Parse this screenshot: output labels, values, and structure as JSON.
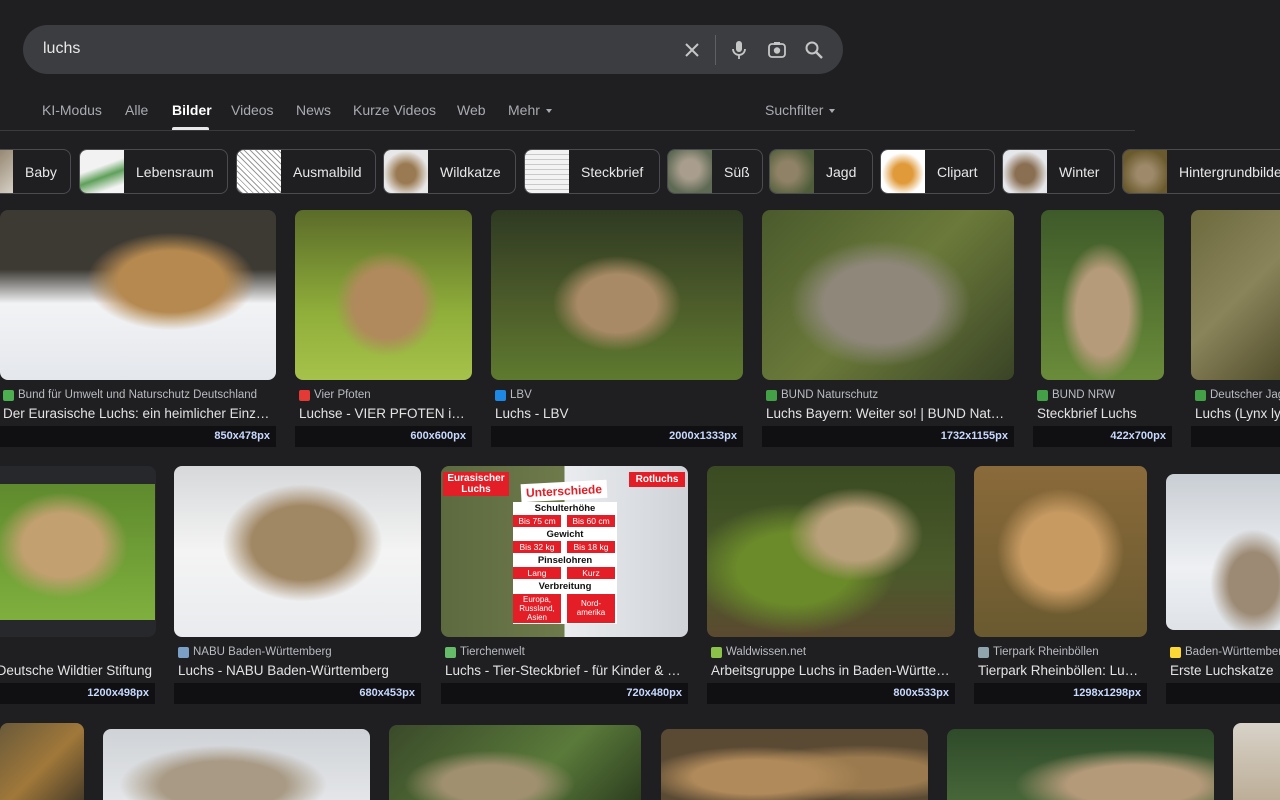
{
  "search": {
    "query": "luchs"
  },
  "tabs": [
    {
      "label": "KI-Modus",
      "active": false
    },
    {
      "label": "Alle",
      "active": false
    },
    {
      "label": "Bilder",
      "active": true
    },
    {
      "label": "Videos",
      "active": false
    },
    {
      "label": "News",
      "active": false
    },
    {
      "label": "Kurze Videos",
      "active": false
    },
    {
      "label": "Web",
      "active": false
    },
    {
      "label": "Mehr",
      "active": false
    }
  ],
  "filter_label": "Suchfilter",
  "chips": [
    "Baby",
    "Lebensraum",
    "Ausmalbild",
    "Wildkatze",
    "Steckbrief",
    "Süß",
    "Jagd",
    "Clipart",
    "Winter",
    "Hintergrundbilder"
  ],
  "results": {
    "row1": [
      {
        "source": "Bund für Umwelt und Naturschutz Deutschland",
        "title": "Der Eurasische Luchs: ein heimlicher Einzelgänger",
        "dims": "850x478px"
      },
      {
        "source": "Vier Pfoten",
        "title": "Luchse - VIER PFOTEN in Deutschland",
        "dims": "600x600px"
      },
      {
        "source": "LBV",
        "title": "Luchs - LBV",
        "dims": "2000x1333px"
      },
      {
        "source": "BUND Naturschutz",
        "title": "Luchs Bayern: Weiter so! | BUND Naturschutz",
        "dims": "1732x1155px"
      },
      {
        "source": "BUND NRW",
        "title": "Steckbrief Luchs",
        "dims": "422x700px"
      },
      {
        "source": "Deutscher Jagdverband",
        "title": "Luchs (Lynx lynx)",
        "dims": ""
      }
    ],
    "row2": [
      {
        "source": "Deutsche Wildtier Stiftung",
        "title": "Deutsche Wildtier Stiftung",
        "dims": "1200x498px"
      },
      {
        "source": "NABU Baden-Württemberg",
        "title": "Luchs - NABU Baden-Württemberg",
        "dims": "680x453px"
      },
      {
        "source": "Tierchenwelt",
        "title": "Luchs - Tier-Steckbrief - für Kinder & Erwachsene",
        "dims": "720x480px"
      },
      {
        "source": "Waldwissen.net",
        "title": "Arbeitsgruppe Luchs in Baden-Württemberg",
        "dims": "800x533px"
      },
      {
        "source": "Tierpark Rheinböllen",
        "title": "Tierpark Rheinböllen: Luchse",
        "dims": "1298x1298px"
      },
      {
        "source": "Baden-Württemberg.de",
        "title": "Erste Luchskatze",
        "dims": ""
      }
    ]
  },
  "infographic": {
    "left_label": "Eurasischer Luchs",
    "right_label": "Rotluchs",
    "heading": "Unterschiede",
    "rows": [
      {
        "label": "Schulterhöhe",
        "left": "Bis 75 cm",
        "right": "Bis 60 cm"
      },
      {
        "label": "Gewicht",
        "left": "Bis 32 kg",
        "right": "Bis 18 kg"
      },
      {
        "label": "Pinselohren",
        "left": "Lang",
        "right": "Kurz"
      },
      {
        "label": "Verbreitung",
        "left": "Europa, Russland, Asien",
        "right": "Nord-amerika"
      }
    ]
  },
  "colors": {
    "background": "#1f1f22",
    "searchbar": "#3c3d40",
    "dims_text": "#c7d9ff"
  },
  "icons": [
    "close-icon",
    "microphone-icon",
    "camera-lens-icon",
    "search-icon"
  ]
}
